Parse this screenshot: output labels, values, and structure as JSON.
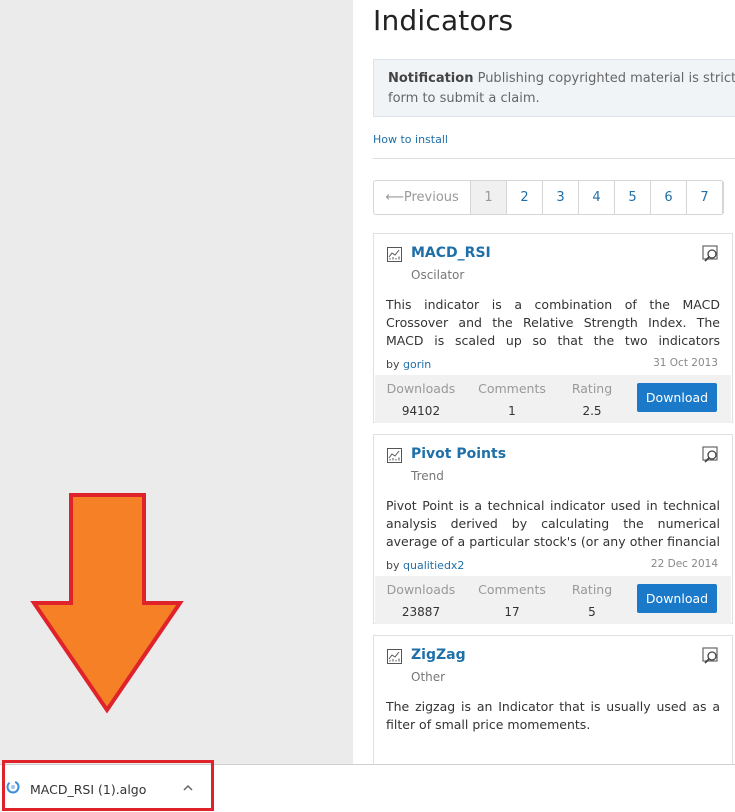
{
  "page": {
    "title": "Indicators",
    "notice": {
      "label": "Notification",
      "line1": " Publishing copyrighted material is strictly proh",
      "line2": "form to submit a claim."
    },
    "how_to_install": "How to install"
  },
  "pagination": {
    "previous": "⟵Previous",
    "pages": [
      "1",
      "2",
      "3",
      "4",
      "5",
      "6",
      "7"
    ],
    "active": "1"
  },
  "cards": [
    {
      "name": "MACD_RSI",
      "category": "Oscilator",
      "description": "This indicator is a combination of the MACD Crossover and the Relative Strength Index. The MACD is scaled up so that the two indicators overlap.",
      "by_label": "by",
      "author": "gorin",
      "date": "31 Oct 2013",
      "downloads_label": "Downloads",
      "downloads": "94102",
      "comments_label": "Comments",
      "comments": "1",
      "rating_label": "Rating",
      "rating": "2.5",
      "button": "Download"
    },
    {
      "name": "Pivot Points",
      "category": "Trend",
      "description": "Pivot Point is a technical indicator used in technical analysis derived by calculating the numerical average of a particular stock's (or any other financial asset like",
      "by_label": "by",
      "author": "qualitiedx2",
      "date": "22 Dec 2014",
      "downloads_label": "Downloads",
      "downloads": "23887",
      "comments_label": "Comments",
      "comments": "17",
      "rating_label": "Rating",
      "rating": "5",
      "button": "Download"
    },
    {
      "name": "ZigZag",
      "category": "Other",
      "description": "The zigzag is an Indicator that is usually used as a filter of small price momements."
    }
  ],
  "download_bar": {
    "file_name": "MACD_RSI (1).algo"
  },
  "icons": {
    "indicator": "chart-icon",
    "zoom": "zoom-icon",
    "file": "file-icon",
    "chevron": "chevron-up-icon"
  },
  "colors": {
    "link": "#1f6fa8",
    "download_button": "#1a79c9",
    "arrow_fill": "#f58025",
    "highlight": "#e0232b"
  }
}
